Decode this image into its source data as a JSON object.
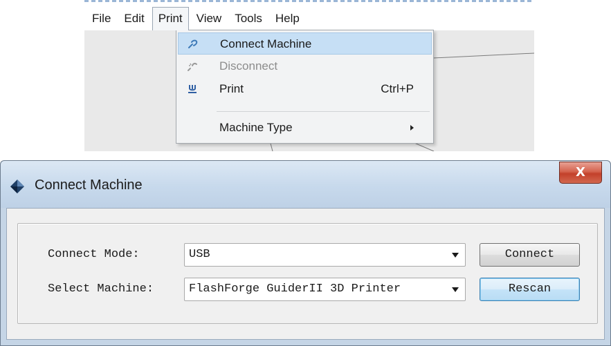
{
  "menubar": {
    "items": [
      "File",
      "Edit",
      "Print",
      "View",
      "Tools",
      "Help"
    ],
    "open_index": 2
  },
  "print_menu": {
    "items": [
      {
        "label": "Connect Machine",
        "icon": "connect-icon",
        "state": "highlighted",
        "shortcut": ""
      },
      {
        "label": "Disconnect",
        "icon": "disconnect-icon",
        "state": "disabled",
        "shortcut": ""
      },
      {
        "label": "Print",
        "icon": "print-icon",
        "state": "normal",
        "shortcut": "Ctrl+P"
      },
      {
        "label": "Machine Type",
        "icon": "",
        "state": "submenu",
        "shortcut": ""
      }
    ]
  },
  "dialog": {
    "title": "Connect Machine",
    "close_label": "X",
    "connect_mode_label": "Connect Mode:",
    "connect_mode_value": "USB",
    "select_machine_label": "Select Machine:",
    "select_machine_value": "FlashForge GuiderII 3D Printer",
    "connect_button": "Connect",
    "rescan_button": "Rescan"
  },
  "colors": {
    "menu_highlight": "#c6dff5",
    "dialog_frame": "#c5d5e6",
    "close_button": "#c3402a",
    "default_button": "#3c7fb1"
  }
}
